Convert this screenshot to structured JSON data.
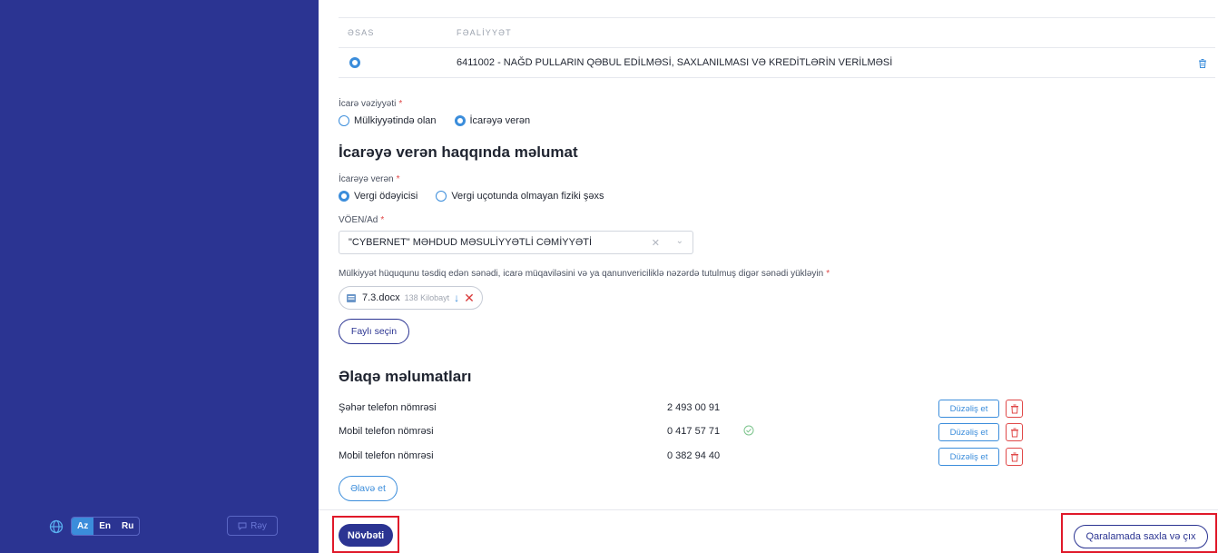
{
  "sidebar": {
    "languages": [
      "Az",
      "En",
      "Ru"
    ],
    "active_language": "Az",
    "feedback_label": "Rəy",
    "bg_color": "#2b3492"
  },
  "activity_table": {
    "headers": {
      "main": "ƏSAS",
      "activity": "FƏALİYYƏT"
    },
    "rows": [
      {
        "main_selected": true,
        "activity": "6411002 - NAĞD PULLARIN QƏBUL EDİLMƏSİ, SAXLANILMASI VƏ KREDİTLƏRİN VERİLMƏSİ"
      }
    ]
  },
  "lease_status": {
    "label": "İcarə vəziyyəti",
    "options": [
      "Mülkiyyətində olan",
      "İcarəyə verən"
    ],
    "selected": "İcarəyə verən"
  },
  "lessor_section": {
    "title": "İcarəyə verən haqqında məlumat",
    "lessor_type": {
      "label": "İcarəyə verən",
      "options": [
        "Vergi ödəyicisi",
        "Vergi uçotunda olmayan fiziki şəxs"
      ],
      "selected": "Vergi ödəyicisi"
    },
    "voen": {
      "label": "VÖEN/Ad",
      "value": "\"CYBERNET\" MƏHDUD MƏSULİYYƏTLİ CƏMİYYƏTİ"
    },
    "document": {
      "label": "Mülkiyyət hüququnu təsdiq edən sənədi, icarə müqaviləsini və ya qanunvericiliklə nəzərdə tutulmuş digər sənədi yükləyin",
      "file_name": "7.3.docx",
      "file_size": "138 Kilobayt",
      "choose_label": "Faylı seçin"
    }
  },
  "contacts": {
    "title": "Əlaqə məlumatları",
    "edit_label": "Düzəliş et",
    "rows": [
      {
        "label": "Şəhər telefon nömrəsi",
        "value": "2 493 00 91",
        "verified": false
      },
      {
        "label": "Mobil telefon nömrəsi",
        "value": "0 417 57 71",
        "verified": true
      },
      {
        "label": "Mobil telefon nömrəsi",
        "value": "0 382 94 40",
        "verified": false
      }
    ],
    "add_label": "Əlavə et"
  },
  "footer": {
    "next_label": "Növbəti",
    "draft_label": "Qaralamada saxla və çıx"
  },
  "colors": {
    "primary": "#2b3492",
    "accent": "#3b8ddb",
    "danger": "#e04848",
    "highlight": "#e0192a"
  }
}
